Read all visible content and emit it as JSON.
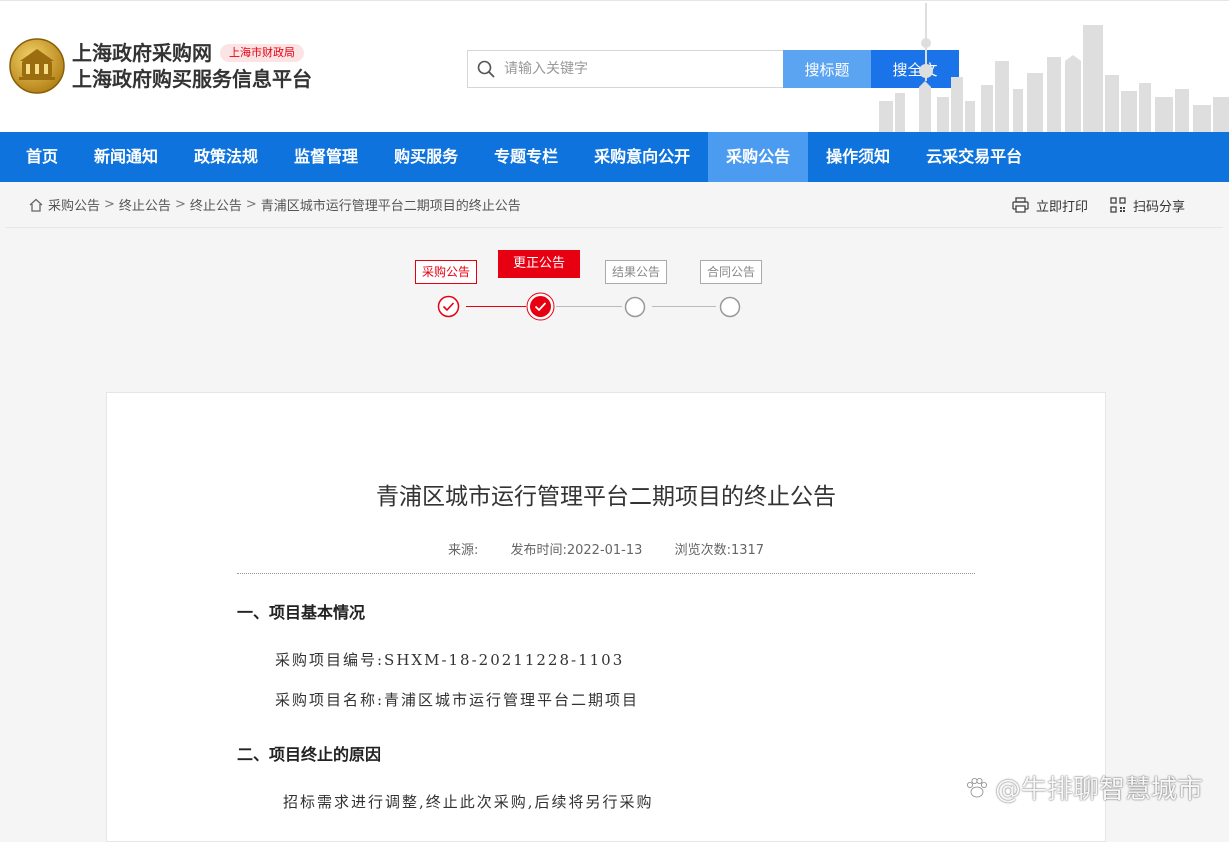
{
  "header": {
    "site_name": "上海政府采购网",
    "site_subtitle": "上海政府购买服务信息平台",
    "tag": "上海市财政局",
    "search_placeholder": "请输入关键字",
    "btn_search_title": "搜标题",
    "btn_search_full": "搜全文"
  },
  "nav": {
    "items": [
      "首页",
      "新闻通知",
      "政策法规",
      "监督管理",
      "购买服务",
      "专题专栏",
      "采购意向公开",
      "采购公告",
      "操作须知",
      "云采交易平台"
    ],
    "active": "采购公告"
  },
  "breadcrumb": [
    "采购公告",
    "终止公告",
    "终止公告",
    "青浦区城市运行管理平台二期项目的终止公告"
  ],
  "breadcrumb_sep": ">",
  "tools": {
    "print": "立即打印",
    "share": "扫码分享"
  },
  "steps": [
    {
      "label": "采购公告",
      "state": "done"
    },
    {
      "label": "更正公告",
      "state": "current"
    },
    {
      "label": "结果公告",
      "state": "pending"
    },
    {
      "label": "合同公告",
      "state": "pending"
    }
  ],
  "article": {
    "title": "青浦区城市运行管理平台二期项目的终止公告",
    "source_label": "来源:",
    "publish_label": "发布时间:",
    "publish_date": "2022-01-13",
    "views_label": "浏览次数:",
    "views": "1317",
    "section1_title": "一、项目基本情况",
    "project_no": "采购项目编号:SHXM-18-20211228-1103",
    "project_name": "采购项目名称:青浦区城市运行管理平台二期项目",
    "section2_title": "二、项目终止的原因",
    "reason": "招标需求进行调整,终止此次采购,后续将另行采购"
  },
  "watermark": "@牛排聊智慧城市",
  "colors": {
    "nav_bg": "#0e73dc",
    "nav_active": "#4b9bf0",
    "accent_red": "#e60012"
  }
}
